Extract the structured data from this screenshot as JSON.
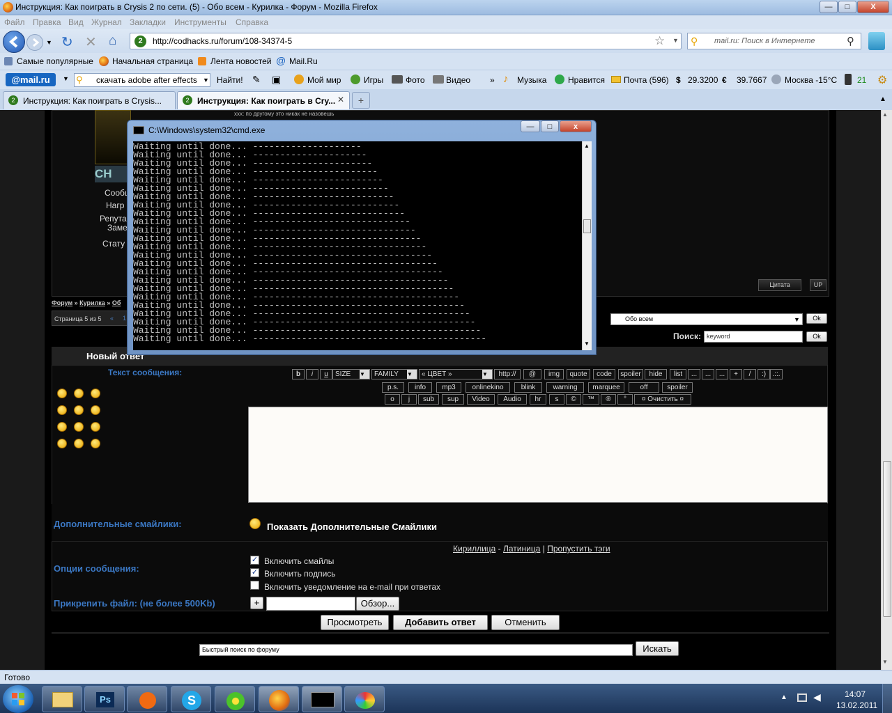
{
  "window": {
    "title": "Инструкция: Как поиграть в Crysis 2 по сети. (5) - Обо всем - Курилка - Форум - Mozilla Firefox",
    "min": "—",
    "max": "□",
    "close": "X"
  },
  "menu": [
    "Файл",
    "Правка",
    "Вид",
    "Журнал",
    "Закладки",
    "Инструменты",
    "Справка"
  ],
  "url": "http://codhacks.ru/forum/108-34374-5",
  "search_placeholder": "mail.ru: Поиск в Интернете",
  "bookmarks": [
    "Самые популярные",
    "Начальная страница",
    "Лента новостей",
    "Mail.Ru"
  ],
  "mailbar": {
    "logo": "@mail.ru",
    "query": "скачать adobe after effects",
    "find": "Найти!",
    "items": [
      "Мой мир",
      "Игры",
      "Фото",
      "Видео",
      "»",
      "Музыка",
      "Нравится",
      "Почта (596)",
      "29.3200",
      "39.7667",
      "Москва -15°C",
      "21"
    ],
    "dollar": "$",
    "euro": "€"
  },
  "tabs": [
    {
      "label": "Инструкция: Как поиграть в Crysis...",
      "active": false
    },
    {
      "label": "Инструкция: Как поиграть в Cry...",
      "active": true
    }
  ],
  "tab_new": "+",
  "forum": {
    "quote_text": "xxx: по другому это никак не назовешь",
    "logo": "CH",
    "profile_labels": [
      "Сообщ",
      "Нагр",
      "Репута",
      "Заме",
      "Стату"
    ],
    "quote_btn": "Цитата",
    "up_btn": "UP",
    "breadcrumb": [
      "Форум",
      "Курилка",
      "Об"
    ],
    "breadcrumb_sep": "»",
    "pages": "Страница 5 из 5",
    "page_links": [
      "«",
      "1"
    ],
    "section_select": "Обо всем",
    "ok": "Ok",
    "search_label": "Поиск:",
    "search_value": "keyword",
    "new_reply": "Новый ответ",
    "message_label": "Текст сообщения:",
    "toolbar_row1": [
      "b",
      "i",
      "u",
      "SIZE",
      "FAMILY",
      "« ЦВЕТ »",
      "http://",
      "@",
      "img",
      "quote",
      "code",
      "spoiler",
      "hide",
      "list",
      "...",
      "...",
      "...",
      "+",
      "/",
      ":)",
      ".::."
    ],
    "toolbar_row2": [
      "p.s.",
      "info",
      "mp3",
      "onlinekino",
      "blink",
      "warning",
      "marquee",
      "off",
      "spoiler"
    ],
    "toolbar_row3": [
      "o",
      "j",
      "sub",
      "sup",
      "Video",
      "Audio",
      "hr",
      "s",
      "©",
      "™",
      "®",
      "°",
      "¤ Очистить ¤"
    ],
    "extra_smiles_label": "Дополнительные смайлики:",
    "extra_smiles_link": "Показать Дополнительные Смайлики",
    "translit": [
      "Кириллица",
      "Латиница",
      "Пропустить тэги"
    ],
    "translit_seps": [
      "-",
      "|"
    ],
    "options_label": "Опции сообщения:",
    "options": [
      {
        "label": "Включить смайлы",
        "checked": true
      },
      {
        "label": "Включить подпись",
        "checked": true
      },
      {
        "label": "Включить уведомление на e-mail при ответах",
        "checked": false
      }
    ],
    "attach_label": "Прикрепить файл: (не более 500Kb)",
    "attach_add": "+",
    "browse": "Обзор...",
    "preview": "Просмотреть",
    "submit": "Добавить ответ",
    "cancel": "Отменить",
    "quick_search": "Быстрый поиск по форуму",
    "search_btn": "Искать"
  },
  "cmd": {
    "title": "C:\\Windows\\system32\\cmd.exe",
    "line_text": "Waiting until done...",
    "line_count": 24,
    "min": "—",
    "max": "□",
    "close": "x"
  },
  "status": "Готово",
  "taskbar": {
    "apps": [
      "explorer",
      "photoshop",
      "media-player",
      "skype",
      "icq",
      "firefox",
      "cmd",
      "paint"
    ],
    "ps_label": "Ps",
    "time": "14:07",
    "date": "13.02.2011"
  }
}
